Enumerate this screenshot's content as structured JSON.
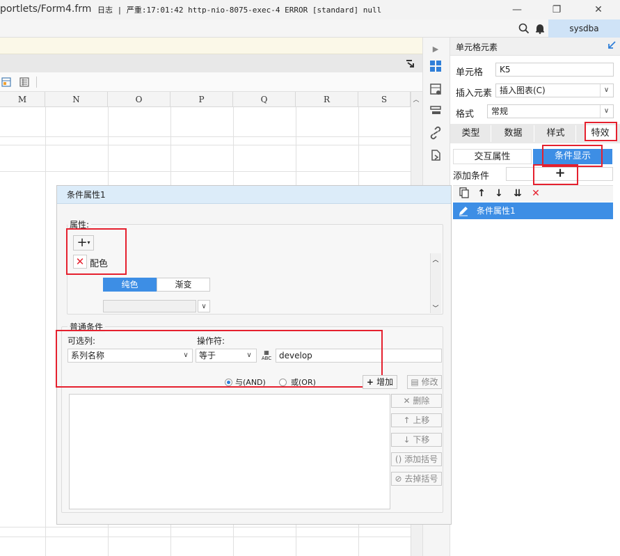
{
  "window": {
    "title": "portlets/Form4.frm",
    "minimize_glyph": "—",
    "restore_glyph": "❐",
    "close_glyph": "✕"
  },
  "logbar": {
    "text": "日志 | 严重:17:01:42 http-nio-8075-exec-4 ERROR [standard] null",
    "user": "sysdba"
  },
  "sheet": {
    "columns": [
      "M",
      "N",
      "O",
      "P",
      "Q",
      "R",
      "S"
    ]
  },
  "right_panel": {
    "header": "单元格元素",
    "cell_label": "单元格",
    "cell_value": "K5",
    "insert_label": "插入元素",
    "insert_value": "插入图表(C)",
    "format_label": "格式",
    "format_value": "常规",
    "tabs": [
      "类型",
      "数据",
      "样式",
      "特效"
    ],
    "subtabs": [
      "交互属性",
      "条件显示"
    ],
    "add_condition_label": "添加条件",
    "add_glyph": "+",
    "condition_item": "条件属性1"
  },
  "dialog": {
    "title": "条件属性1",
    "attr_label": "属性:",
    "attr_item": "配色",
    "color_tabs": [
      "纯色",
      "渐变"
    ],
    "common_label": "普通条件",
    "column_label": "可选列:",
    "column_value": "系列名称",
    "operator_label": "操作符:",
    "operator_value": "等于",
    "value_text": "develop",
    "abc_glyph": "ABC",
    "and_label": "与(AND)",
    "or_label": "或(OR)",
    "add_label": "增加",
    "edit_label": "修改",
    "delete_label": "删除",
    "up_label": "上移",
    "down_label": "下移",
    "add_paren_label": "添加括号",
    "remove_paren_label": "去掉括号"
  }
}
